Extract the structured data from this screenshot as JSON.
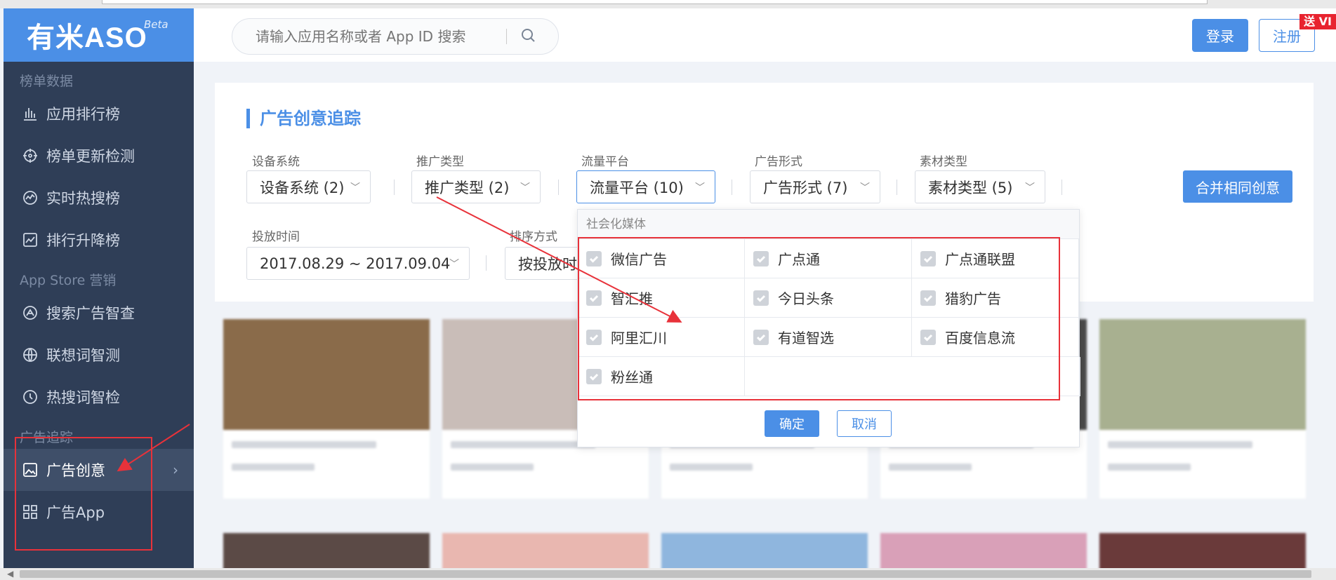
{
  "header": {
    "search_placeholder": "请输入应用名称或者 App ID 搜索",
    "login": "登录",
    "register": "注册",
    "promo": "送 VI"
  },
  "sidebar": {
    "brand": "有米ASO",
    "beta": "Beta",
    "sections": [
      {
        "title": "榜单数据",
        "items": [
          "应用排行榜",
          "榜单更新检测",
          "实时热搜榜",
          "排行升降榜"
        ]
      },
      {
        "title": "App Store 营销",
        "items": [
          "搜索广告智查",
          "联想词智测",
          "热搜词智检"
        ]
      },
      {
        "title": "广告追踪",
        "items": [
          "广告创意",
          "广告App"
        ]
      }
    ],
    "active_chevron": "›"
  },
  "card": {
    "title": "广告创意追踪",
    "filters": [
      {
        "label": "设备系统",
        "value": "设备系统 (2)"
      },
      {
        "label": "推广类型",
        "value": "推广类型 (2)"
      },
      {
        "label": "流量平台",
        "value": "流量平台 (10)"
      },
      {
        "label": "广告形式",
        "value": "广告形式 (7)"
      },
      {
        "label": "素材类型",
        "value": "素材类型 (5)"
      }
    ],
    "date_label": "投放时间",
    "date_value": "2017.08.29 ~ 2017.09.04",
    "sort_label": "排序方式",
    "sort_value": "按投放时",
    "merge_button": "合并相同创意"
  },
  "dropdown": {
    "group": "社会化媒体",
    "options": [
      "微信广告",
      "广点通",
      "广点通联盟",
      "智汇推",
      "今日头条",
      "猎豹广告",
      "阿里汇川",
      "有道智选",
      "百度信息流",
      "粉丝通"
    ],
    "ok": "确定",
    "cancel": "取消"
  },
  "colors": {
    "accent": "#4b8fe6",
    "sidebar": "#2f3e57",
    "annotation": "#e8323a"
  }
}
